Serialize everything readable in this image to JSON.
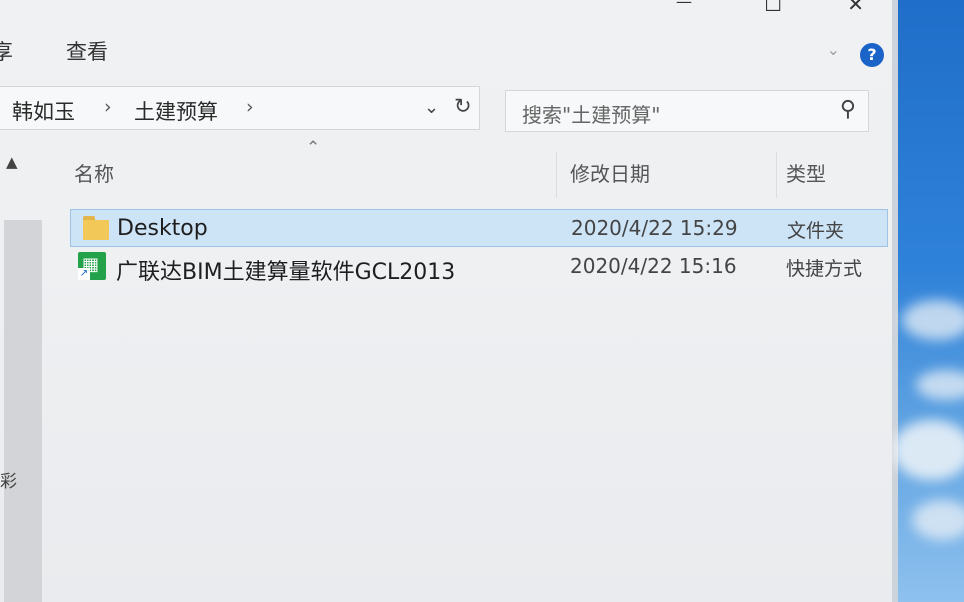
{
  "window": {
    "controls": {
      "minimize": "—",
      "maximize": "☐",
      "close": "✕"
    }
  },
  "ribbon": {
    "tab_fragment": "享",
    "tab_view": "查看"
  },
  "address": {
    "crumbs": [
      "韩如玉",
      "土建预算"
    ],
    "separator": "›"
  },
  "search": {
    "placeholder": "搜索\"土建预算\""
  },
  "nav": {
    "fragment": "彩"
  },
  "columns": {
    "name": "名称",
    "modified": "修改日期",
    "type": "类型"
  },
  "files": [
    {
      "name": "Desktop",
      "modified": "2020/4/22 15:29",
      "type": "文件夹",
      "icon": "folder-icon",
      "selected": true
    },
    {
      "name": "广联达BIM土建算量软件GCL2013",
      "modified": "2020/4/22 15:16",
      "type": "快捷方式",
      "icon": "shortcut-app-icon",
      "selected": false
    }
  ],
  "colors": {
    "selection": "#cde3f6",
    "selection_border": "#9ec3e6",
    "help": "#1a64c8",
    "folder": "#f2c858",
    "app": "#24a24b"
  }
}
